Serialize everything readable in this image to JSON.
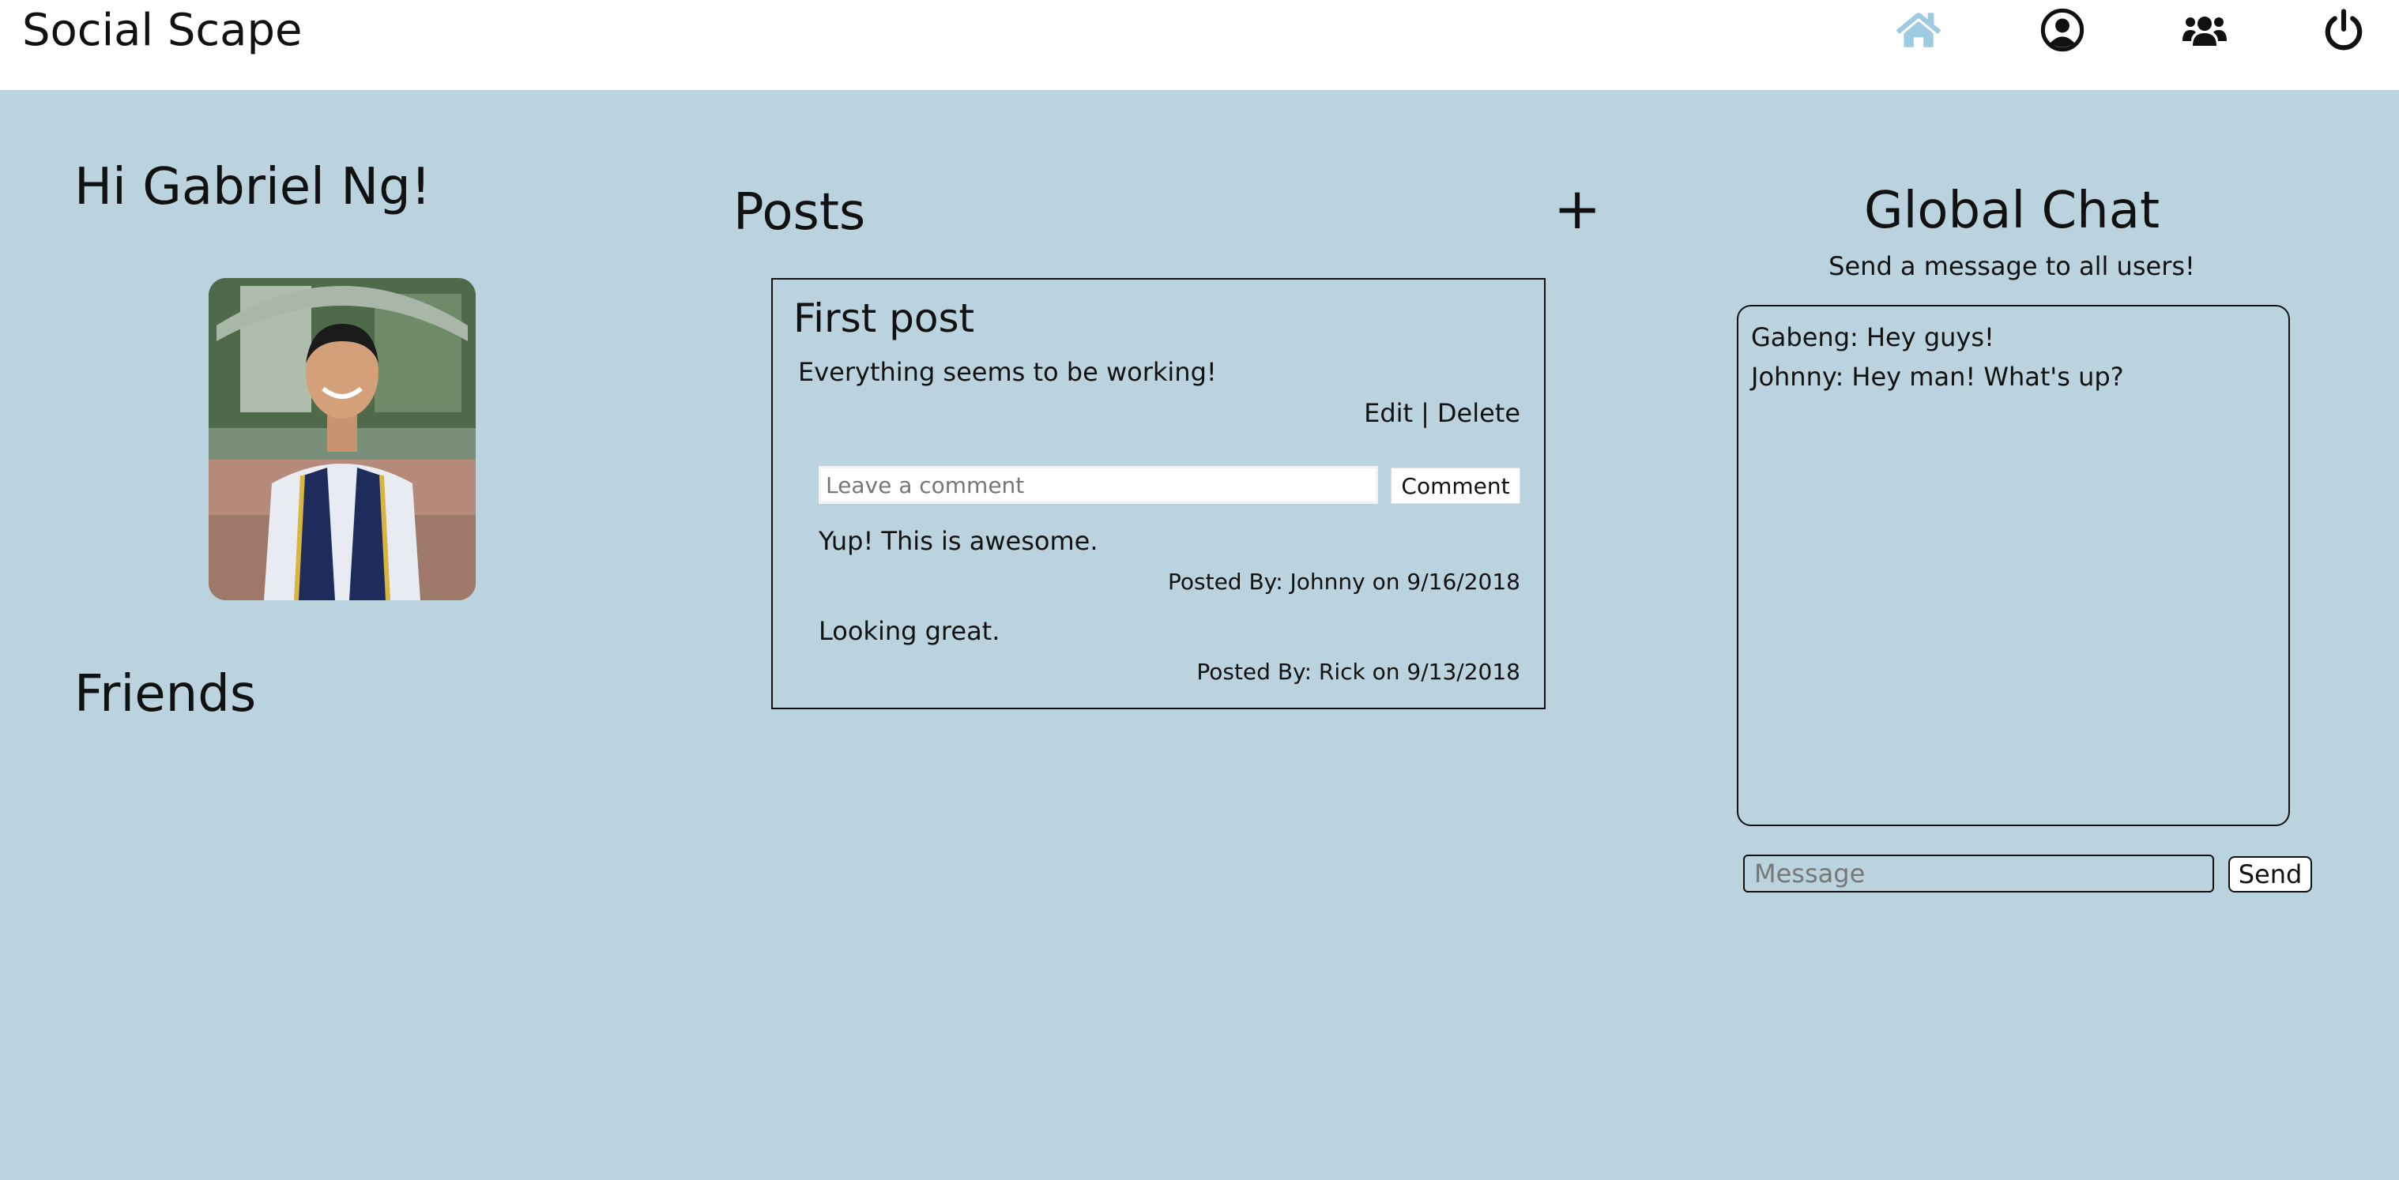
{
  "header": {
    "brand": "Social Scape",
    "nav": [
      {
        "icon": "home-icon",
        "label": "Home",
        "color": "#9fcbe0"
      },
      {
        "icon": "profile-icon",
        "label": "Profile",
        "color": "#111111"
      },
      {
        "icon": "friends-icon",
        "label": "Friends",
        "color": "#111111"
      },
      {
        "icon": "power-icon",
        "label": "Logout",
        "color": "#111111"
      }
    ]
  },
  "profile": {
    "greeting": "Hi Gabriel Ng!",
    "friends_title": "Friends"
  },
  "posts": {
    "title": "Posts",
    "add_symbol": "+",
    "items": [
      {
        "title": "First post",
        "body": "Everything seems to be working!",
        "edit_label": "Edit",
        "separator": "|",
        "delete_label": "Delete",
        "comment_placeholder": "Leave a comment",
        "comment_button": "Comment",
        "comments": [
          {
            "text": "Yup! This is awesome.",
            "meta": "Posted By: Johnny on 9/16/2018"
          },
          {
            "text": "Looking great.",
            "meta": "Posted By: Rick on 9/13/2018"
          }
        ]
      }
    ]
  },
  "chat": {
    "title": "Global Chat",
    "subtitle": "Send a message to all users!",
    "messages": [
      "Gabeng: Hey guys!",
      "Johnny: Hey man! What's up?"
    ],
    "input_placeholder": "Message",
    "send_label": "Send"
  },
  "colors": {
    "background": "#bad3de",
    "header": "#ffffff",
    "active_nav": "#9fcbe0"
  }
}
